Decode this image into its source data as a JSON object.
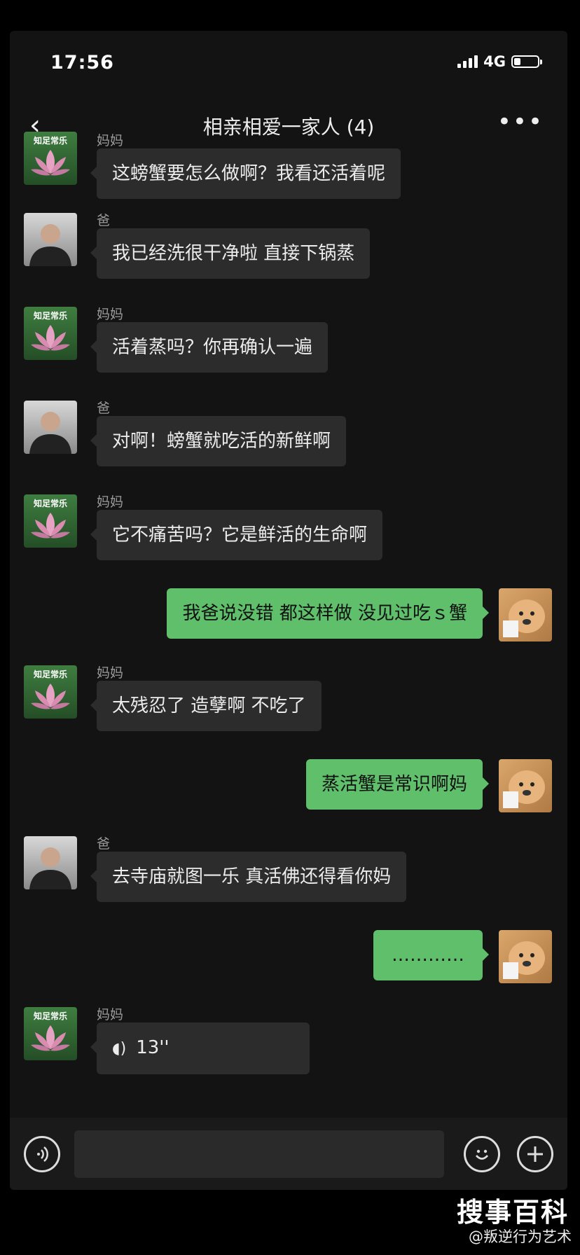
{
  "status": {
    "time": "17:56",
    "network": "4G"
  },
  "nav": {
    "back": "‹",
    "title": "相亲相爱一家人 (4)",
    "more": "•••"
  },
  "chat": {
    "top_name": "妈妈",
    "messages": [
      {
        "sender": "妈妈",
        "text": "这螃蟹要怎么做啊？我看还活着呢"
      },
      {
        "sender": "爸",
        "text": "我已经洗很干净啦 直接下锅蒸"
      },
      {
        "sender": "妈妈",
        "text": "活着蒸吗？你再确认一遍"
      },
      {
        "sender": "爸",
        "text": "对啊！螃蟹就吃活的新鲜啊"
      },
      {
        "sender": "妈妈",
        "text": "它不痛苦吗？它是鲜活的生命啊"
      },
      {
        "sender": "me",
        "text": "我爸说没错 都这样做 没见过吃ｓ蟹"
      },
      {
        "sender": "妈妈",
        "text": "太残忍了 造孽啊 不吃了"
      },
      {
        "sender": "me",
        "text": "蒸活蟹是常识啊妈"
      },
      {
        "sender": "爸",
        "text": "去寺庙就图一乐 真活佛还得看你妈"
      },
      {
        "sender": "me",
        "text": "…………"
      },
      {
        "sender": "妈妈",
        "voice_duration": "13''"
      }
    ],
    "lotus_avatar_label": "知足常乐"
  },
  "inputbar": {
    "voice_icon": "voice-icon",
    "emoji_icon": "emoji-icon",
    "plus_icon": "plus-icon"
  },
  "watermark": {
    "site": "搜事百科",
    "weibo": "@叛逆行为艺术"
  },
  "colors": {
    "my_bubble": "#5fbf6b",
    "their_bubble": "#2c2c2c",
    "background": "#131313"
  }
}
